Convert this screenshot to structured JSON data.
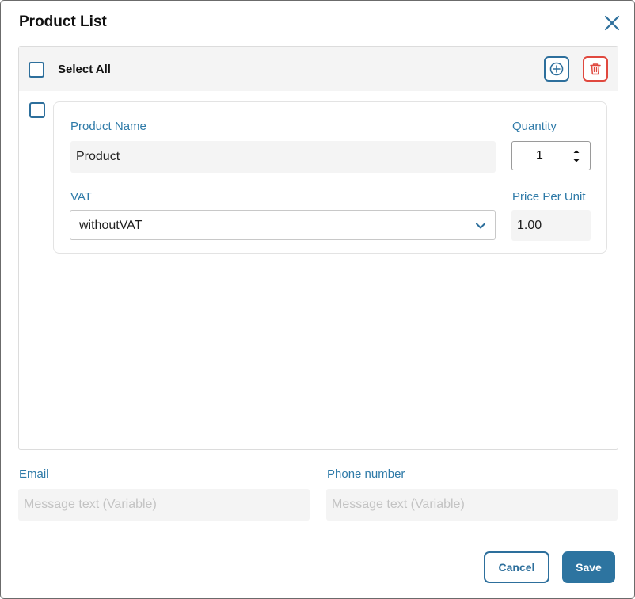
{
  "dialog": {
    "title": "Product List",
    "close_icon": "close-icon"
  },
  "list": {
    "select_all_label": "Select All",
    "add_icon": "plus-circle-icon",
    "delete_icon": "trash-icon",
    "accent_color": "#2d6f9c",
    "danger_color": "#e0483e",
    "items": [
      {
        "product_name_label": "Product Name",
        "product_name_value": "Product",
        "quantity_label": "Quantity",
        "quantity_value": "1",
        "vat_label": "VAT",
        "vat_value": "withoutVAT",
        "price_label": "Price Per Unit",
        "price_value": "1.00"
      }
    ]
  },
  "contact": {
    "email_label": "Email",
    "email_placeholder": "Message text (Variable)",
    "phone_label": "Phone number",
    "phone_placeholder": "Message text (Variable)"
  },
  "actions": {
    "cancel_label": "Cancel",
    "save_label": "Save"
  }
}
